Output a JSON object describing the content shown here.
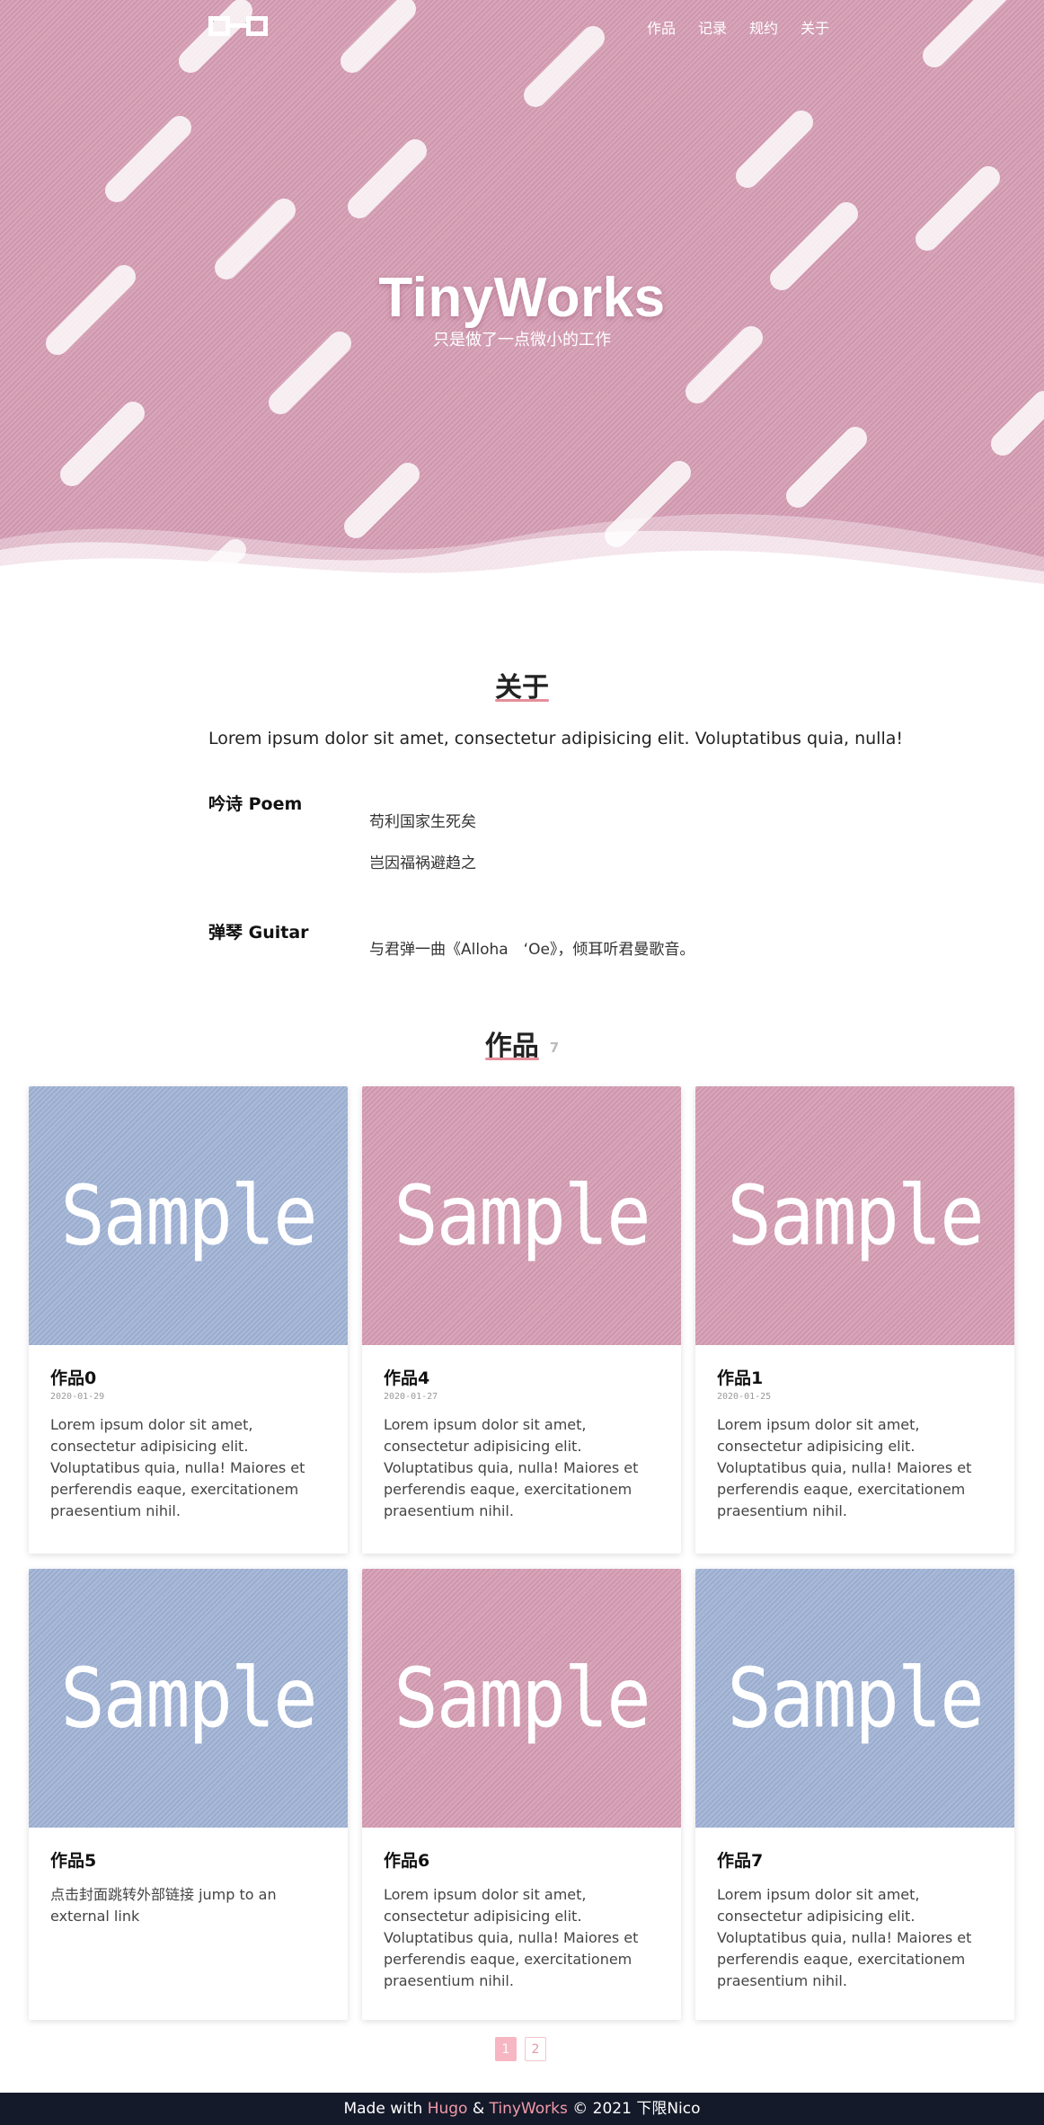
{
  "colors": {
    "hero_bg": "#d7a4b8",
    "card_blue": "#a8b9d8",
    "card_pink": "#d7a4b8",
    "footer_bg": "#141a2a",
    "accent": "#f29aa9"
  },
  "nav": {
    "logo_icon": "window-logo-icon",
    "links": [
      "作品",
      "记录",
      "规约",
      "关于"
    ]
  },
  "hero": {
    "title": "TinyWorks",
    "subtitle": "只是做了一点微小的工作"
  },
  "about": {
    "title": "关于",
    "intro": "Lorem ipsum dolor sit amet, consectetur adipisicing elit. Voluptatibus quia, nulla!",
    "rows": [
      {
        "label": "吟诗 Poem",
        "lines": [
          "苟利国家生死矣",
          "岂因福祸避趋之"
        ]
      },
      {
        "label": "弹琴 Guitar",
        "lines": [
          "与君弹一曲《Alloha　‘Oe》，倾耳听君曼歌音。"
        ]
      }
    ]
  },
  "works": {
    "title": "作品",
    "count": "7",
    "cards": [
      {
        "cover": "Sample",
        "color": "blue",
        "title": "作品0",
        "date": "2020-01-29",
        "desc": "Lorem ipsum dolor sit amet, consectetur adipisicing elit. Voluptatibus quia, nulla! Maiores et perferendis eaque, exercitationem praesentium nihil."
      },
      {
        "cover": "Sample",
        "color": "pink",
        "title": "作品4",
        "date": "2020-01-27",
        "desc": "Lorem ipsum dolor sit amet, consectetur adipisicing elit. Voluptatibus quia, nulla! Maiores et perferendis eaque, exercitationem praesentium nihil."
      },
      {
        "cover": "Sample",
        "color": "pink",
        "title": "作品1",
        "date": "2020-01-25",
        "desc": "Lorem ipsum dolor sit amet, consectetur adipisicing elit. Voluptatibus quia, nulla! Maiores et perferendis eaque, exercitationem praesentium nihil."
      },
      {
        "cover": "Sample",
        "color": "blue",
        "title": "作品5",
        "date": "",
        "desc": "点击封面跳转外部链接 jump to an external link"
      },
      {
        "cover": "Sample",
        "color": "pink",
        "title": "作品6",
        "date": "",
        "desc": "Lorem ipsum dolor sit amet, consectetur adipisicing elit. Voluptatibus quia, nulla! Maiores et perferendis eaque, exercitationem praesentium nihil."
      },
      {
        "cover": "Sample",
        "color": "blue",
        "title": "作品7",
        "date": "",
        "desc": "Lorem ipsum dolor sit amet, consectetur adipisicing elit. Voluptatibus quia, nulla! Maiores et perferendis eaque, exercitationem praesentium nihil."
      }
    ]
  },
  "pagination": {
    "pages": [
      "1",
      "2"
    ],
    "current": "1"
  },
  "footer": {
    "made_with": "Made with",
    "hugo": "Hugo",
    "amp": "&",
    "theme": "TinyWorks",
    "copyright": "© 2021 下限Nico"
  }
}
